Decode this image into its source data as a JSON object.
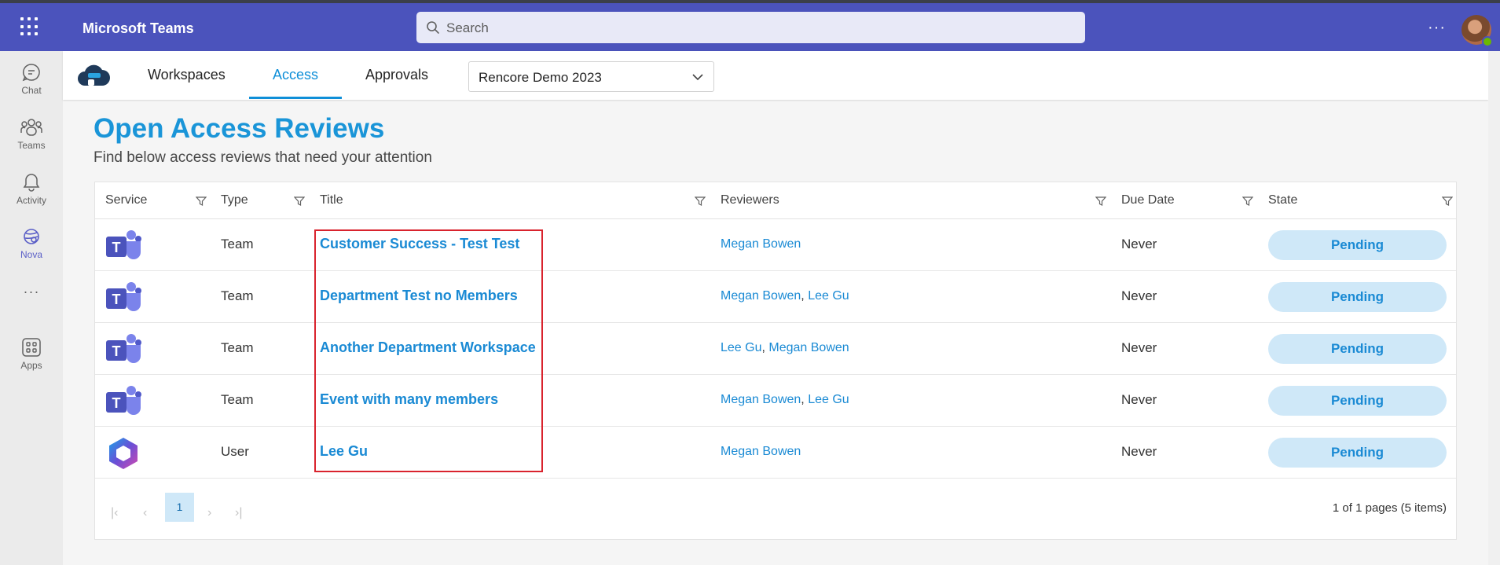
{
  "app": {
    "title": "Microsoft Teams",
    "search_placeholder": "Search",
    "more": "···"
  },
  "rail": {
    "items": [
      {
        "label": "Chat",
        "icon": "chat-icon"
      },
      {
        "label": "Teams",
        "icon": "teams-icon"
      },
      {
        "label": "Activity",
        "icon": "bell-icon"
      },
      {
        "label": "Nova",
        "icon": "nova-icon",
        "active": true
      },
      {
        "label": "···",
        "icon": "more-icon"
      },
      {
        "label": "Apps",
        "icon": "apps-icon"
      }
    ]
  },
  "header": {
    "tabs": [
      "Workspaces",
      "Access",
      "Approvals"
    ],
    "active_tab": "Access",
    "tenant": "Rencore Demo 2023"
  },
  "page": {
    "title": "Open Access Reviews",
    "subtitle": "Find below access reviews that need your attention"
  },
  "table": {
    "columns": [
      "Service",
      "Type",
      "Title",
      "Reviewers",
      "Due Date",
      "State"
    ],
    "rows": [
      {
        "service": "teams-icon",
        "type": "Team",
        "title": "Customer Success - Test Test",
        "reviewers": [
          "Megan Bowen"
        ],
        "due": "Never",
        "state": "Pending"
      },
      {
        "service": "teams-icon",
        "type": "Team",
        "title": "Department Test no Members",
        "reviewers": [
          "Megan Bowen",
          "Lee Gu"
        ],
        "due": "Never",
        "state": "Pending"
      },
      {
        "service": "teams-icon",
        "type": "Team",
        "title": "Another Department Workspace",
        "reviewers": [
          "Lee Gu",
          "Megan Bowen"
        ],
        "due": "Never",
        "state": "Pending"
      },
      {
        "service": "teams-icon",
        "type": "Team",
        "title": "Event with many members",
        "reviewers": [
          "Megan Bowen",
          "Lee Gu"
        ],
        "due": "Never",
        "state": "Pending"
      },
      {
        "service": "m365-icon",
        "type": "User",
        "title": "Lee Gu",
        "reviewers": [
          "Megan Bowen"
        ],
        "due": "Never",
        "state": "Pending"
      }
    ]
  },
  "pager": {
    "current_page": "1",
    "info": "1 of 1 pages (5 items)"
  },
  "colors": {
    "teams_purple": "#4b53bc",
    "accent_blue": "#1a95d8",
    "pending_bg": "#cfe8f8",
    "highlight_red": "#d9232d"
  }
}
